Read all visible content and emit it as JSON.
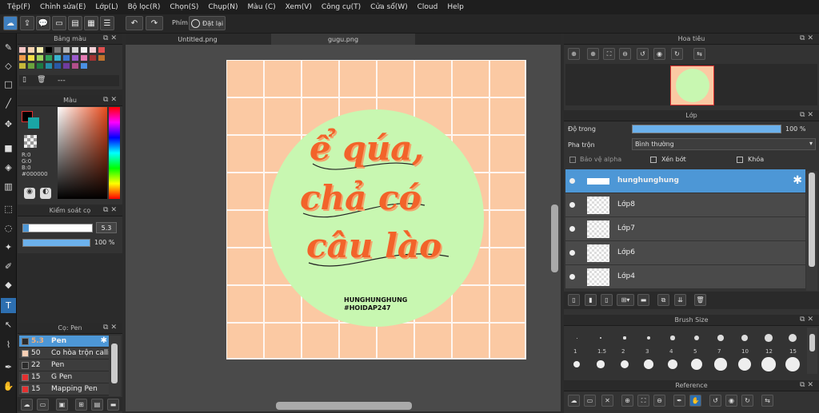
{
  "menu": [
    "Tệp(F)",
    "Chỉnh sửa(E)",
    "Lớp(L)",
    "Bộ lọc(R)",
    "Chọn(S)",
    "Chụp(N)",
    "Màu (C)",
    "Xem(V)",
    "Công cụ(T)",
    "Cửa sổ(W)",
    "Cloud",
    "Help"
  ],
  "toolbar": {
    "phim_label": "Phím",
    "reset_label": "Đặt lại"
  },
  "tabs": [
    "Untitled.png",
    "gugu.png"
  ],
  "palette": {
    "title": "Bảng màu",
    "name": "---",
    "colors": [
      "#f6c6c6",
      "#f7d4b0",
      "#f8f0b0",
      "#000000",
      "#7a7a7a",
      "#b7b7b7",
      "#d6d6d6",
      "#f3f3f3",
      "#f3d0d6",
      "#e05050",
      "#f19a48",
      "#f3de46",
      "#9ad35c",
      "#2fa15b",
      "#3ab3cf",
      "#3b77d1",
      "#9b5bcc",
      "#e37bb3",
      "#a43333",
      "#c0722c",
      "#c7b83a",
      "#6aa43d",
      "#1d7a43",
      "#258ea8",
      "#2a59a6",
      "#6f3c9e",
      "#b24f8a",
      "#4a90e2"
    ]
  },
  "color": {
    "title": "Màu",
    "r": "R:0",
    "g": "G:0",
    "b": "B:0",
    "hex": "#000000"
  },
  "brush_control": {
    "title": "Kiểm soát cọ",
    "size": "5.3",
    "opacity": "100 %",
    "size_fill": 1.0,
    "opacity_fill": 1.0
  },
  "brush": {
    "title": "Cọ: Pen",
    "items": [
      {
        "size": "5.3",
        "name": "Pen",
        "color": "#2b2b2b"
      },
      {
        "size": "50",
        "name": "Co hòa trộn calli",
        "color": "#f7cfb5"
      },
      {
        "size": "22",
        "name": "Pen",
        "color": "#2b2b2b"
      },
      {
        "size": "15",
        "name": "G Pen",
        "color": "#e53030"
      },
      {
        "size": "15",
        "name": "Mapping Pen",
        "color": "#e53030"
      }
    ]
  },
  "artwork": {
    "line1": "ể qúa,",
    "line2": "chả có",
    "line3": "câu lào",
    "sig1": "HUNGHUNGHUNG",
    "sig2": "#HOIDAP247"
  },
  "navigator": {
    "title": "Hoa tiêu"
  },
  "layer": {
    "title": "Lớp",
    "opacity_label": "Độ trong",
    "opacity_value": "100 %",
    "opacity_fill": 1.0,
    "blend_label": "Pha trộn",
    "blend_value": "Bình thường",
    "protect_alpha": "Bảo vệ alpha",
    "clip": "Xén bớt",
    "lock": "Khóa",
    "layers": [
      "hunghunghung",
      "Lớp8",
      "Lớp7",
      "Lớp6",
      "Lớp4"
    ]
  },
  "brush_size": {
    "title": "Brush Size",
    "sizes": [
      "1",
      "1.5",
      "2",
      "3",
      "4",
      "5",
      "7",
      "10",
      "12",
      "15"
    ]
  },
  "reference": {
    "title": "Reference"
  },
  "colors": {
    "accent": "#4d97d6",
    "canvas_bg": "#fbc9a3",
    "circle": "#c8f7b1",
    "lettering": "#f2632a"
  }
}
